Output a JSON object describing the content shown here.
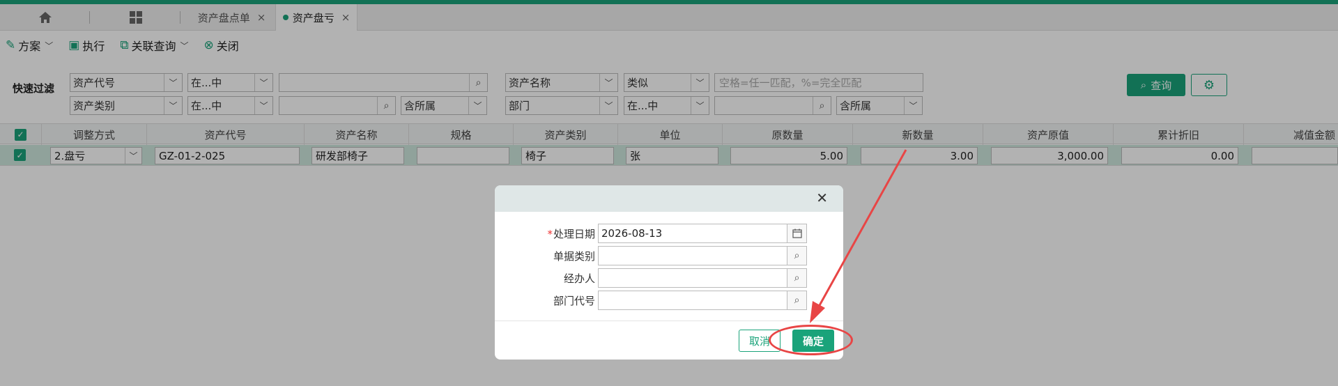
{
  "tabs": {
    "home_icon": "home-icon",
    "grid_icon": "apps-grid-icon",
    "items": [
      {
        "label": "资产盘点单",
        "close": "×"
      },
      {
        "label": "资产盘亏",
        "close": "×"
      }
    ]
  },
  "toolbar": {
    "scheme": "方案",
    "execute": "执行",
    "related_query": "关联查询",
    "close": "关闭"
  },
  "filter": {
    "label": "快速过滤",
    "row1": {
      "field1": "资产代号",
      "op1": "在...中",
      "value1": "",
      "field2": "资产名称",
      "op2": "类似",
      "value2_placeholder": "空格=任一匹配，%=完全匹配"
    },
    "row2": {
      "field1": "资产类别",
      "op1": "在...中",
      "value1": "",
      "scope1": "含所属",
      "field2": "部门",
      "op2": "在...中",
      "value2": "",
      "scope2": "含所属"
    },
    "query_button": "查询"
  },
  "grid": {
    "headers": [
      "调整方式",
      "资产代号",
      "资产名称",
      "规格",
      "资产类别",
      "单位",
      "原数量",
      "新数量",
      "资产原值",
      "累计折旧",
      "减值金额"
    ],
    "row": {
      "checked": true,
      "adjust": "2.盘亏",
      "code": "GZ-01-2-025",
      "name": "研发部椅子",
      "spec": "",
      "category": "椅子",
      "unit": "张",
      "orig_qty": "5.00",
      "new_qty": "3.00",
      "orig_value": "3,000.00",
      "depreciation": "0.00",
      "impairment": ""
    }
  },
  "dialog": {
    "fields": [
      {
        "label": "处理日期",
        "required": true,
        "value": "2026-08-13",
        "icon": "calendar-icon"
      },
      {
        "label": "单据类别",
        "required": false,
        "value": "",
        "icon": "search-icon"
      },
      {
        "label": "经办人",
        "required": false,
        "value": "",
        "icon": "search-icon"
      },
      {
        "label": "部门代号",
        "required": false,
        "value": "",
        "icon": "search-icon"
      }
    ],
    "cancel": "取消",
    "ok": "确定"
  },
  "colors": {
    "accent": "#1aa37a",
    "annotation": "#e84545"
  }
}
